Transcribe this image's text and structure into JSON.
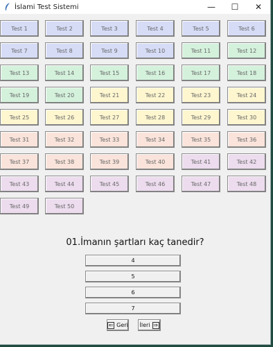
{
  "window": {
    "title": "İslami Test Sistemi",
    "controls": {
      "minimize": "—",
      "maximize": "☐",
      "close": "✕"
    }
  },
  "tests": [
    {
      "label": "Test 1",
      "color": "blue"
    },
    {
      "label": "Test 2",
      "color": "blue"
    },
    {
      "label": "Test 3",
      "color": "blue"
    },
    {
      "label": "Test 4",
      "color": "blue"
    },
    {
      "label": "Test 5",
      "color": "blue"
    },
    {
      "label": "Test 6",
      "color": "blue"
    },
    {
      "label": "Test 7",
      "color": "blue"
    },
    {
      "label": "Test 8",
      "color": "blue"
    },
    {
      "label": "Test 9",
      "color": "blue"
    },
    {
      "label": "Test 10",
      "color": "blue"
    },
    {
      "label": "Test 11",
      "color": "green"
    },
    {
      "label": "Test 12",
      "color": "green"
    },
    {
      "label": "Test 13",
      "color": "green"
    },
    {
      "label": "Test 14",
      "color": "green"
    },
    {
      "label": "Test 15",
      "color": "green"
    },
    {
      "label": "Test 16",
      "color": "green"
    },
    {
      "label": "Test 17",
      "color": "green"
    },
    {
      "label": "Test 18",
      "color": "green"
    },
    {
      "label": "Test 19",
      "color": "green"
    },
    {
      "label": "Test 20",
      "color": "green"
    },
    {
      "label": "Test 21",
      "color": "yellow"
    },
    {
      "label": "Test 22",
      "color": "yellow"
    },
    {
      "label": "Test 23",
      "color": "yellow"
    },
    {
      "label": "Test 24",
      "color": "yellow"
    },
    {
      "label": "Test 25",
      "color": "yellow"
    },
    {
      "label": "Test 26",
      "color": "yellow"
    },
    {
      "label": "Test 27",
      "color": "yellow"
    },
    {
      "label": "Test 28",
      "color": "yellow"
    },
    {
      "label": "Test 29",
      "color": "yellow"
    },
    {
      "label": "Test 30",
      "color": "yellow"
    },
    {
      "label": "Test 31",
      "color": "peach"
    },
    {
      "label": "Test 32",
      "color": "peach"
    },
    {
      "label": "Test 33",
      "color": "peach"
    },
    {
      "label": "Test 34",
      "color": "peach"
    },
    {
      "label": "Test 35",
      "color": "peach"
    },
    {
      "label": "Test 36",
      "color": "peach"
    },
    {
      "label": "Test 37",
      "color": "peach"
    },
    {
      "label": "Test 38",
      "color": "peach"
    },
    {
      "label": "Test 39",
      "color": "peach"
    },
    {
      "label": "Test 40",
      "color": "peach"
    },
    {
      "label": "Test 41",
      "color": "purple"
    },
    {
      "label": "Test 42",
      "color": "purple"
    },
    {
      "label": "Test 43",
      "color": "purple"
    },
    {
      "label": "Test 44",
      "color": "purple"
    },
    {
      "label": "Test 45",
      "color": "purple"
    },
    {
      "label": "Test 46",
      "color": "purple"
    },
    {
      "label": "Test 47",
      "color": "purple"
    },
    {
      "label": "Test 48",
      "color": "purple"
    },
    {
      "label": "Test 49",
      "color": "purple"
    },
    {
      "label": "Test 50",
      "color": "purple"
    }
  ],
  "question": {
    "text": "01.İmanın şartları kaç tanedir?",
    "options": [
      "4",
      "5",
      "6",
      "7"
    ]
  },
  "nav": {
    "back_label": "Geri",
    "back_icon": "⇐",
    "next_label": "İleri",
    "next_icon": "⇒"
  }
}
